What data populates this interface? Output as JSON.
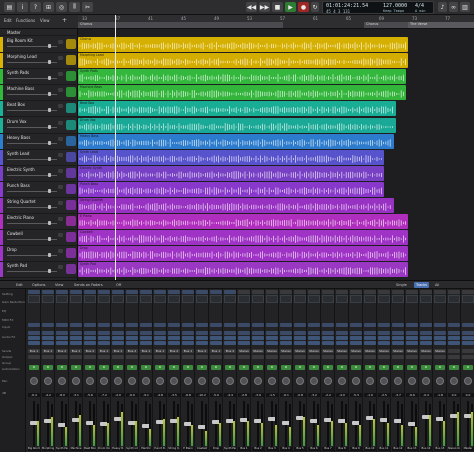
{
  "control_bar": {
    "lcd_position": "01:01:24:21.54",
    "lcd_bars": "45  4  3 131",
    "lcd_tempo": "127.0000",
    "lcd_tempo_label": "Keep  Tempo",
    "lcd_signature": "4/4",
    "lcd_key": "A min"
  },
  "track_area": {
    "menus": [
      "Edit",
      "Functions",
      "View"
    ],
    "master_label": "Master"
  },
  "ruler": {
    "bars": [
      "33",
      "37",
      "41",
      "45",
      "49",
      "53",
      "57",
      "61",
      "65",
      "69",
      "73",
      "77"
    ],
    "markers": [
      {
        "label": "Chorus"
      },
      {
        "label": "Chorus"
      },
      {
        "label": "The Verse"
      }
    ]
  },
  "tracks": [
    {
      "name": "Big Room Kit",
      "color": "#d9b300"
    },
    {
      "name": "Morphing Lead",
      "color": "#d9b300"
    },
    {
      "name": "Synth Pads",
      "color": "#2fba3a"
    },
    {
      "name": "Machine Bass",
      "color": "#2fba3a"
    },
    {
      "name": "Beat Box",
      "color": "#1ab39a"
    },
    {
      "name": "Drum Vox",
      "color": "#1ab39a"
    },
    {
      "name": "Heavy Bass",
      "color": "#2b7fcf"
    },
    {
      "name": "Synth Lead",
      "color": "#5a55d1"
    },
    {
      "name": "Electric Synth",
      "color": "#7a3fc9"
    },
    {
      "name": "Punch Bass",
      "color": "#8a3ad0"
    },
    {
      "name": "String Quartet",
      "color": "#9b33c7"
    },
    {
      "name": "Electric Piano",
      "color": "#b32fc0"
    },
    {
      "name": "Cowbell",
      "color": "#a233c9"
    },
    {
      "name": "Drop",
      "color": "#a233c9"
    },
    {
      "name": "Synth Pad",
      "color": "#9a38c8"
    }
  ],
  "regions": [
    {
      "track": 0,
      "label": "Chorus",
      "color": "#d6b000",
      "end": 330
    },
    {
      "track": 1,
      "label": "Morphing Lead",
      "color": "#d3ad00",
      "end": 330
    },
    {
      "track": 2,
      "label": "Synth Pads",
      "color": "#34b73d",
      "end": 328
    },
    {
      "track": 3,
      "label": "Machine Bass",
      "color": "#33b53c",
      "end": 328
    },
    {
      "track": 4,
      "label": "Beat Box",
      "color": "#19ad95",
      "end": 318
    },
    {
      "track": 5,
      "label": "Drum Vox",
      "color": "#1aa996",
      "end": 318
    },
    {
      "track": 6,
      "label": "Heavy Bass",
      "color": "#2c7bcc",
      "end": 316
    },
    {
      "track": 7,
      "label": "Synth Lead",
      "color": "#5753cc",
      "end": 306
    },
    {
      "track": 8,
      "label": "Electric Synth",
      "color": "#7740c5",
      "end": 306
    },
    {
      "track": 9,
      "label": "Punch Bass",
      "color": "#8839cc",
      "end": 306
    },
    {
      "track": 10,
      "label": "String Quartet",
      "color": "#9832c2",
      "end": 316
    },
    {
      "track": 11,
      "label": "E Piano",
      "color": "#b02ebd",
      "end": 330
    },
    {
      "track": 12,
      "label": "Cowbell",
      "color": "#9f33c5",
      "end": 330
    },
    {
      "track": 13,
      "label": "Drop",
      "color": "#9f33c5",
      "end": 330
    },
    {
      "track": 14,
      "label": "Synth Pad",
      "color": "#9a38c4",
      "end": 330
    }
  ],
  "mixer": {
    "menus": [
      "Edit",
      "Options",
      "View",
      "Sends on Faders",
      "Off"
    ],
    "view_tabs": [
      "Single",
      "Tracks",
      "All"
    ],
    "row_labels": [
      "Setting",
      "Gain Reduction",
      "EQ",
      "MIDI FX",
      "Input",
      "Audio FX",
      "Sends",
      "Output",
      "Group",
      "Automation",
      "Pan",
      "dB"
    ],
    "strips": [
      {
        "name": "Big Room",
        "send": "Bus 1",
        "db": "-6.4",
        "level": 0.55,
        "meter": 0.6
      },
      {
        "name": "Morphing",
        "send": "Bus 1",
        "db": "-4.2",
        "level": 0.58,
        "meter": 0.7
      },
      {
        "name": "Synth Pads",
        "send": "Bus 2",
        "db": "-8.0",
        "level": 0.5,
        "meter": 0.45
      },
      {
        "name": "Machine",
        "send": "Bus 1",
        "db": "-3.1",
        "level": 0.62,
        "meter": 0.75
      },
      {
        "name": "Beat Box",
        "send": "Bus 2",
        "db": "-5.6",
        "level": 0.55,
        "meter": 0.5
      },
      {
        "name": "Drum Vox",
        "send": "Bus 1",
        "db": "-7.2",
        "level": 0.52,
        "meter": 0.55
      },
      {
        "name": "Heavy B.",
        "send": "Bus 1",
        "db": "-2.0",
        "level": 0.64,
        "meter": 0.8
      },
      {
        "name": "Synth Ld",
        "send": "Bus 2",
        "db": "-6.0",
        "level": 0.54,
        "meter": 0.6
      },
      {
        "name": "Electric",
        "send": "Bus 1",
        "db": "-9.1",
        "level": 0.48,
        "meter": 0.4
      },
      {
        "name": "Punch B.",
        "send": "Bus 1",
        "db": "-4.8",
        "level": 0.57,
        "meter": 0.65
      },
      {
        "name": "String Q.",
        "send": "Bus 2",
        "db": "-3.5",
        "level": 0.6,
        "meter": 0.7
      },
      {
        "name": "E Piano",
        "send": "Bus 1",
        "db": "-6.8",
        "level": 0.53,
        "meter": 0.5
      },
      {
        "name": "Cowbell",
        "send": "Bus 2",
        "db": "-10.2",
        "level": 0.46,
        "meter": 0.35
      },
      {
        "name": "Drop",
        "send": "Bus 1",
        "db": "-5.0",
        "level": 0.56,
        "meter": 0.55
      },
      {
        "name": "Synth Pad",
        "send": "Bus 2",
        "db": "-4.4",
        "level": 0.58,
        "meter": 0.6
      },
      {
        "name": "Bus 1",
        "send": "Stereo",
        "db": "-2.8",
        "level": 0.61,
        "meter": 0.6
      },
      {
        "name": "Bus 2",
        "send": "Stereo",
        "db": "-3.9",
        "level": 0.59,
        "meter": 0.55
      },
      {
        "name": "Bus 3",
        "send": "Stereo",
        "db": "-1.5",
        "level": 0.63,
        "meter": 0.5
      },
      {
        "name": "Bus 4",
        "send": "Stereo",
        "db": "-6.1",
        "level": 0.54,
        "meter": 0.45
      },
      {
        "name": "Bus 5",
        "send": "Stereo",
        "db": "-0.8",
        "level": 0.66,
        "meter": 0.7
      },
      {
        "name": "Bus 6",
        "send": "Stereo",
        "db": "-3.2",
        "level": 0.6,
        "meter": 0.5
      },
      {
        "name": "Bus 7",
        "send": "Stereo",
        "db": "-2.2",
        "level": 0.62,
        "meter": 0.6
      },
      {
        "name": "Bus 8",
        "send": "Stereo",
        "db": "-4.0",
        "level": 0.58,
        "meter": 0.55
      },
      {
        "name": "Bus 9",
        "send": "Stereo",
        "db": "-5.3",
        "level": 0.55,
        "meter": 0.5
      },
      {
        "name": "Bus 10",
        "send": "Stereo",
        "db": "-1.0",
        "level": 0.65,
        "meter": 0.65
      },
      {
        "name": "Bus 11",
        "send": "Stereo",
        "db": "-2.5",
        "level": 0.61,
        "meter": 0.55
      },
      {
        "name": "Bus 12",
        "send": "Stereo",
        "db": "-3.7",
        "level": 0.59,
        "meter": 0.5
      },
      {
        "name": "Bus 13",
        "send": "Stereo",
        "db": "-6.6",
        "level": 0.53,
        "meter": 0.45
      },
      {
        "name": "Bus 14",
        "send": "Stereo",
        "db": "-0.4",
        "level": 0.68,
        "meter": 0.75
      },
      {
        "name": "Bus 15",
        "send": "Stereo",
        "db": "-1.8",
        "level": 0.63,
        "meter": 0.6
      },
      {
        "name": "Stereo Out",
        "send": "",
        "db": "0.0",
        "level": 0.7,
        "meter": 0.8
      },
      {
        "name": "Master",
        "send": "",
        "db": "0.0",
        "level": 0.7,
        "meter": 0.8
      }
    ]
  }
}
